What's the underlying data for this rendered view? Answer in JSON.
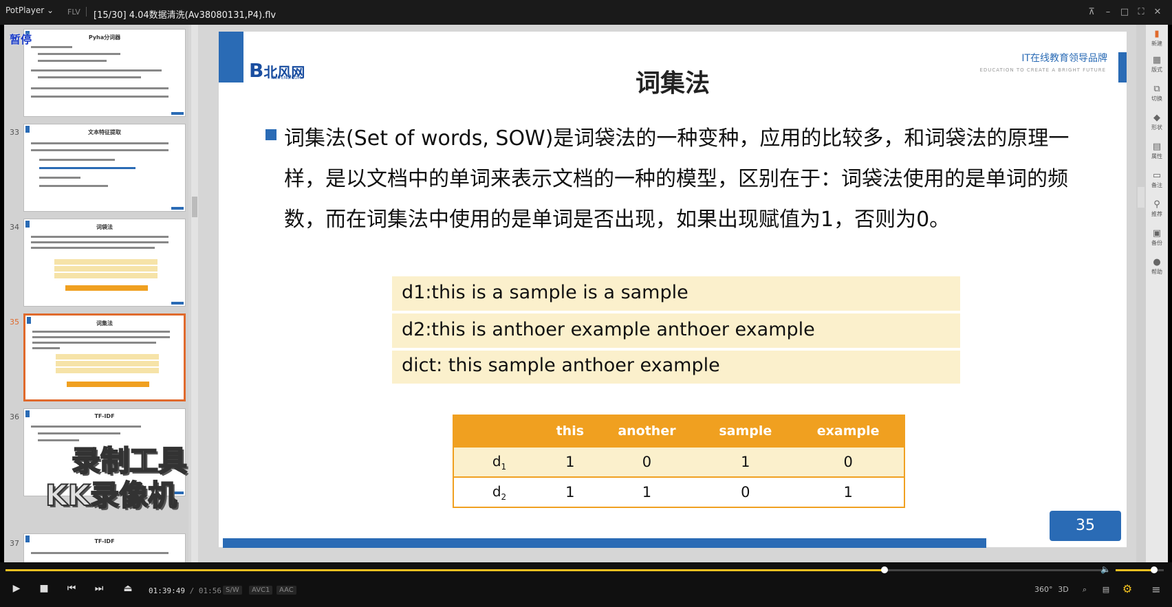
{
  "titlebar": {
    "app": "PotPlayer",
    "format": "FLV",
    "file_title": "[15/30] 4.04数据清洗(Av38080131,P4).flv"
  },
  "overlay": {
    "paused": "暂停",
    "watermark_line1": "录制工具",
    "watermark_line2": "KK录像机"
  },
  "thumbnails": [
    {
      "num": "",
      "title": "Pyha分词器"
    },
    {
      "num": "33",
      "title": "文本特征提取"
    },
    {
      "num": "34",
      "title": "词袋法"
    },
    {
      "num": "35",
      "title": "词集法"
    },
    {
      "num": "36",
      "title": "TF-IDF"
    },
    {
      "num": "37",
      "title": "TF-IDF"
    }
  ],
  "slide": {
    "logo": "北风网",
    "logo_sub": "IBEIFENG.COM",
    "brand": "IT在线教育领导品牌",
    "brand_sub": "EDUCATION TO CREATE A BRIGHT FUTURE",
    "title": "词集法",
    "paragraph": "词集法(Set of words, SOW)是词袋法的一种变种，应用的比较多，和词袋法的原理一样，是以文档中的单词来表示文档的一种的模型，区别在于：词袋法使用的是单词的频数，而在词集法中使用的是单词是否出现，如果出现赋值为1，否则为0。",
    "examples": [
      "d1:this is a sample is a sample",
      "d2:this is anthoer example anthoer example",
      "dict: this sample anthoer example"
    ],
    "table": {
      "headers": [
        "",
        "this",
        "another",
        "sample",
        "example"
      ],
      "rows": [
        {
          "label": "d",
          "sub": "1",
          "values": [
            "1",
            "0",
            "1",
            "0"
          ]
        },
        {
          "label": "d",
          "sub": "2",
          "values": [
            "1",
            "1",
            "0",
            "1"
          ]
        }
      ]
    },
    "page_number": "35"
  },
  "toolstrip": [
    {
      "icon": "new-slide-icon",
      "label": "新建"
    },
    {
      "icon": "layout-icon",
      "label": "版式"
    },
    {
      "icon": "switch-icon",
      "label": "切换"
    },
    {
      "icon": "shape-icon",
      "label": "形状"
    },
    {
      "icon": "property-icon",
      "label": "属性"
    },
    {
      "icon": "notes-icon",
      "label": "备注"
    },
    {
      "icon": "recommend-icon",
      "label": "推荐"
    },
    {
      "icon": "backup-icon",
      "label": "备份"
    },
    {
      "icon": "help-icon",
      "label": "帮助"
    }
  ],
  "player": {
    "progress": 0.8,
    "volume": 0.8,
    "current_time": "01:39:49",
    "total_time": "01:56:02",
    "badges": [
      "S/W",
      "AVC1",
      "AAC"
    ],
    "right_buttons": [
      "360°",
      "3D",
      "⌕",
      "▤",
      "⚙",
      "≡"
    ]
  }
}
